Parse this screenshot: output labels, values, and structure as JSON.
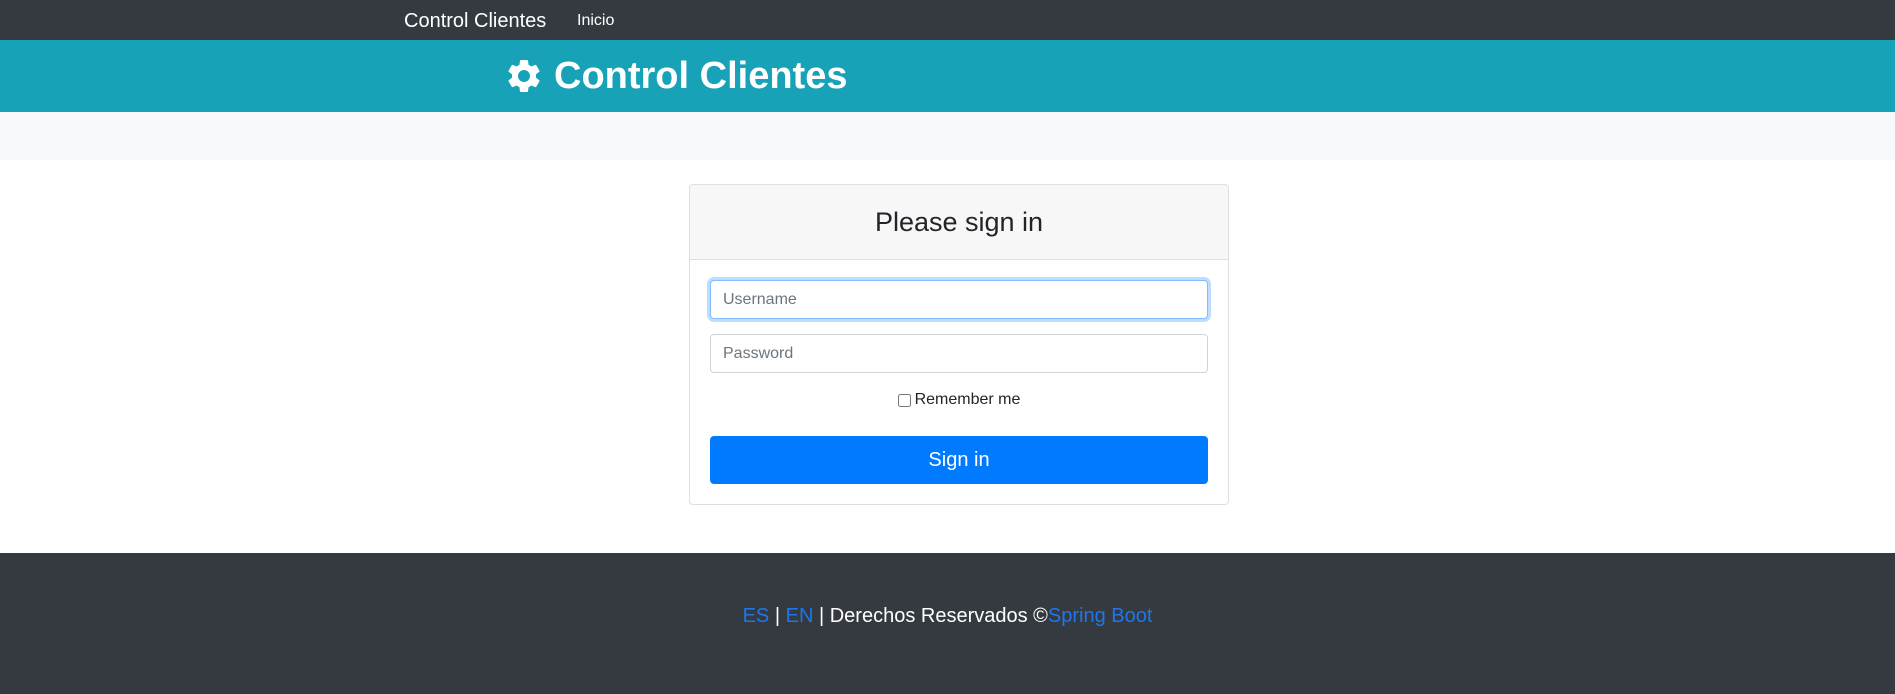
{
  "navbar": {
    "brand": "Control Clientes",
    "links": [
      "Inicio"
    ]
  },
  "header": {
    "icon": "gear-icon",
    "title": "Control Clientes"
  },
  "login": {
    "title": "Please sign in",
    "username": {
      "placeholder": "Username",
      "value": ""
    },
    "password": {
      "placeholder": "Password",
      "value": ""
    },
    "remember_label": "Remember me",
    "remember_checked": false,
    "submit_label": "Sign in"
  },
  "footer": {
    "lang_es": "ES",
    "separator": "|",
    "lang_en": "EN",
    "rights_text": "| Derechos Reservados ©",
    "link_text": "Spring Boot"
  },
  "colors": {
    "navbar_bg": "#343a40",
    "header_bg": "#17a2b8",
    "primary": "#007bff",
    "link": "#1e77ea"
  }
}
